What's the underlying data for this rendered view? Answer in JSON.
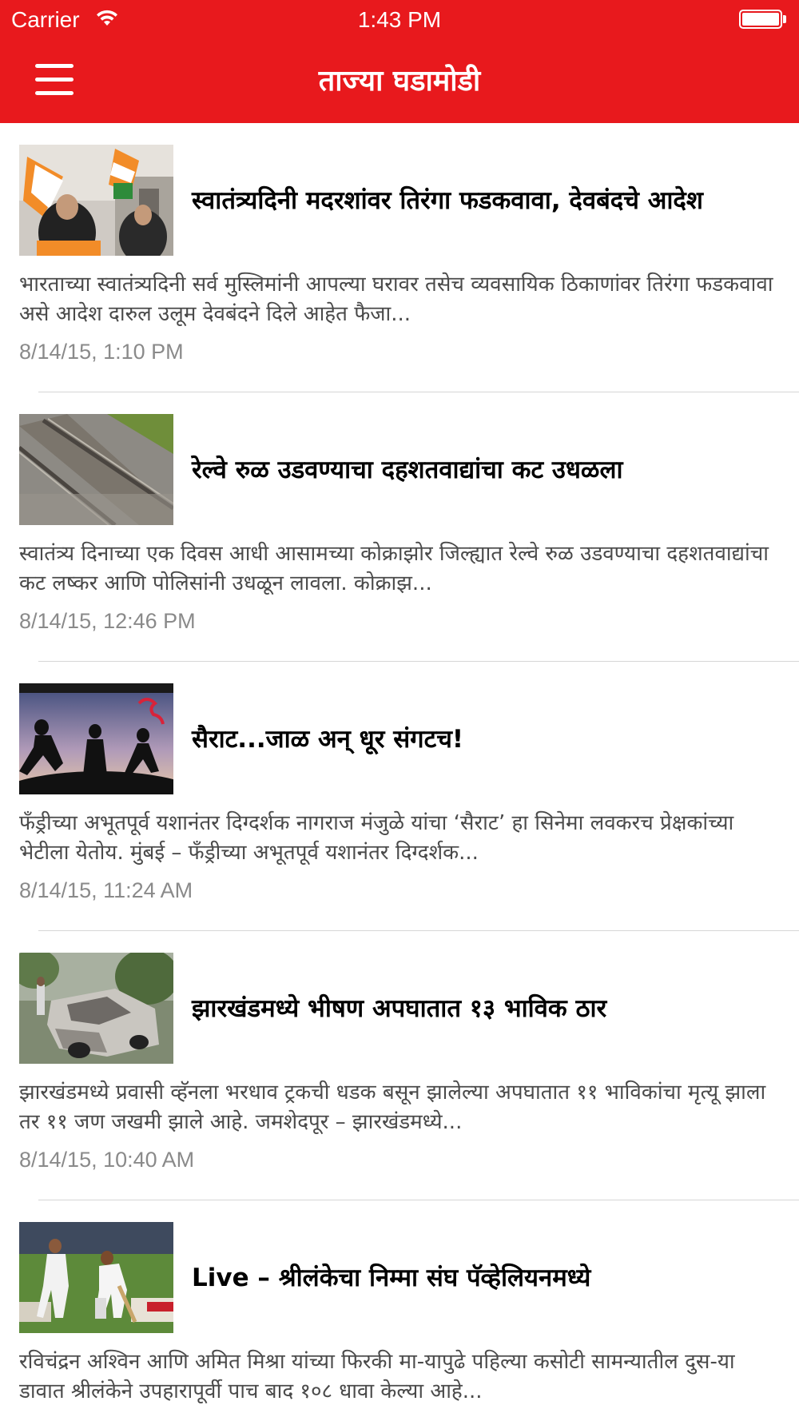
{
  "status_bar": {
    "carrier": "Carrier",
    "time": "1:43 PM",
    "wifi_icon": "wifi-icon",
    "battery_icon": "battery-icon"
  },
  "nav": {
    "menu_icon": "hamburger-menu-icon",
    "title": "ताज्या घडामोडी",
    "bar_color": "#e8191d"
  },
  "articles": [
    {
      "headline": "स्वातंत्र्यदिनी मदरशांवर तिरंगा फडकवावा, देवबंदचे आदेश",
      "summary": "भारताच्या स्वातंत्र्यदिनी सर्व मुस्लिमांनी आपल्या घरावर तसेच व्यवसायिक ठिकाणांवर तिरंगा फडकवावा असे आदेश दारुल उलूम देवबंदने दिले आहेत फैजा...",
      "date": "8/14/15, 1:10 PM",
      "thumbnail": "flags-photo-thumbnail"
    },
    {
      "headline": "रेल्वे रुळ उडवण्याचा दहशतवाद्यांचा कट उधळला",
      "summary": "स्वातंत्र्य दिनाच्या एक दिवस आधी आसामच्या कोक्राझोर जिल्ह्यात रेल्वे रुळ उडवण्याचा दहशतवाद्यांचा कट लष्कर आणि पोलिसांनी उधळून लावला. कोक्राझ...",
      "date": "8/14/15, 12:46 PM",
      "thumbnail": "railway-track-thumbnail"
    },
    {
      "headline": "सैराट...जाळ अन् धूर संगटच!",
      "summary": "फँड्रीच्या अभूतपूर्व यशानंतर दिग्दर्शक नागराज मंजुळे यांचा ‘सैराट’ हा सिनेमा लवकरच प्रेक्षकांच्या भेटीला येतोय. मुंबई – फँड्रीच्या अभूतपूर्व यशानंतर दिग्दर्शक...",
      "date": "8/14/15, 11:24 AM",
      "thumbnail": "movie-poster-thumbnail"
    },
    {
      "headline": "झारखंडमध्ये भीषण अपघातात १३ भाविक ठार",
      "summary": "झारखंडमध्ये प्रवासी व्हॅनला भरधाव ट्रकची धडक बसून झालेल्या अपघातात ११ भाविकांचा मृत्यू झाला तर ११ जण जखमी झाले आहे. जमशेदपूर – झारखंडमध्ये...",
      "date": "8/14/15, 10:40 AM",
      "thumbnail": "accident-car-thumbnail"
    },
    {
      "headline": "Live – श्रीलंकेचा निम्मा संघ पॅव्हेलियनमध्ये",
      "summary": "रविचंद्रन अश्विन आणि अमित मिश्रा यांच्या फिरकी मा-यापुढे पहिल्या कसोटी सामन्यातील दुस-या डावात श्रीलंकेने उपहारापूर्वी पाच बाद १०८ धावा केल्या आहे...",
      "date": "",
      "thumbnail": "cricket-match-thumbnail"
    }
  ]
}
